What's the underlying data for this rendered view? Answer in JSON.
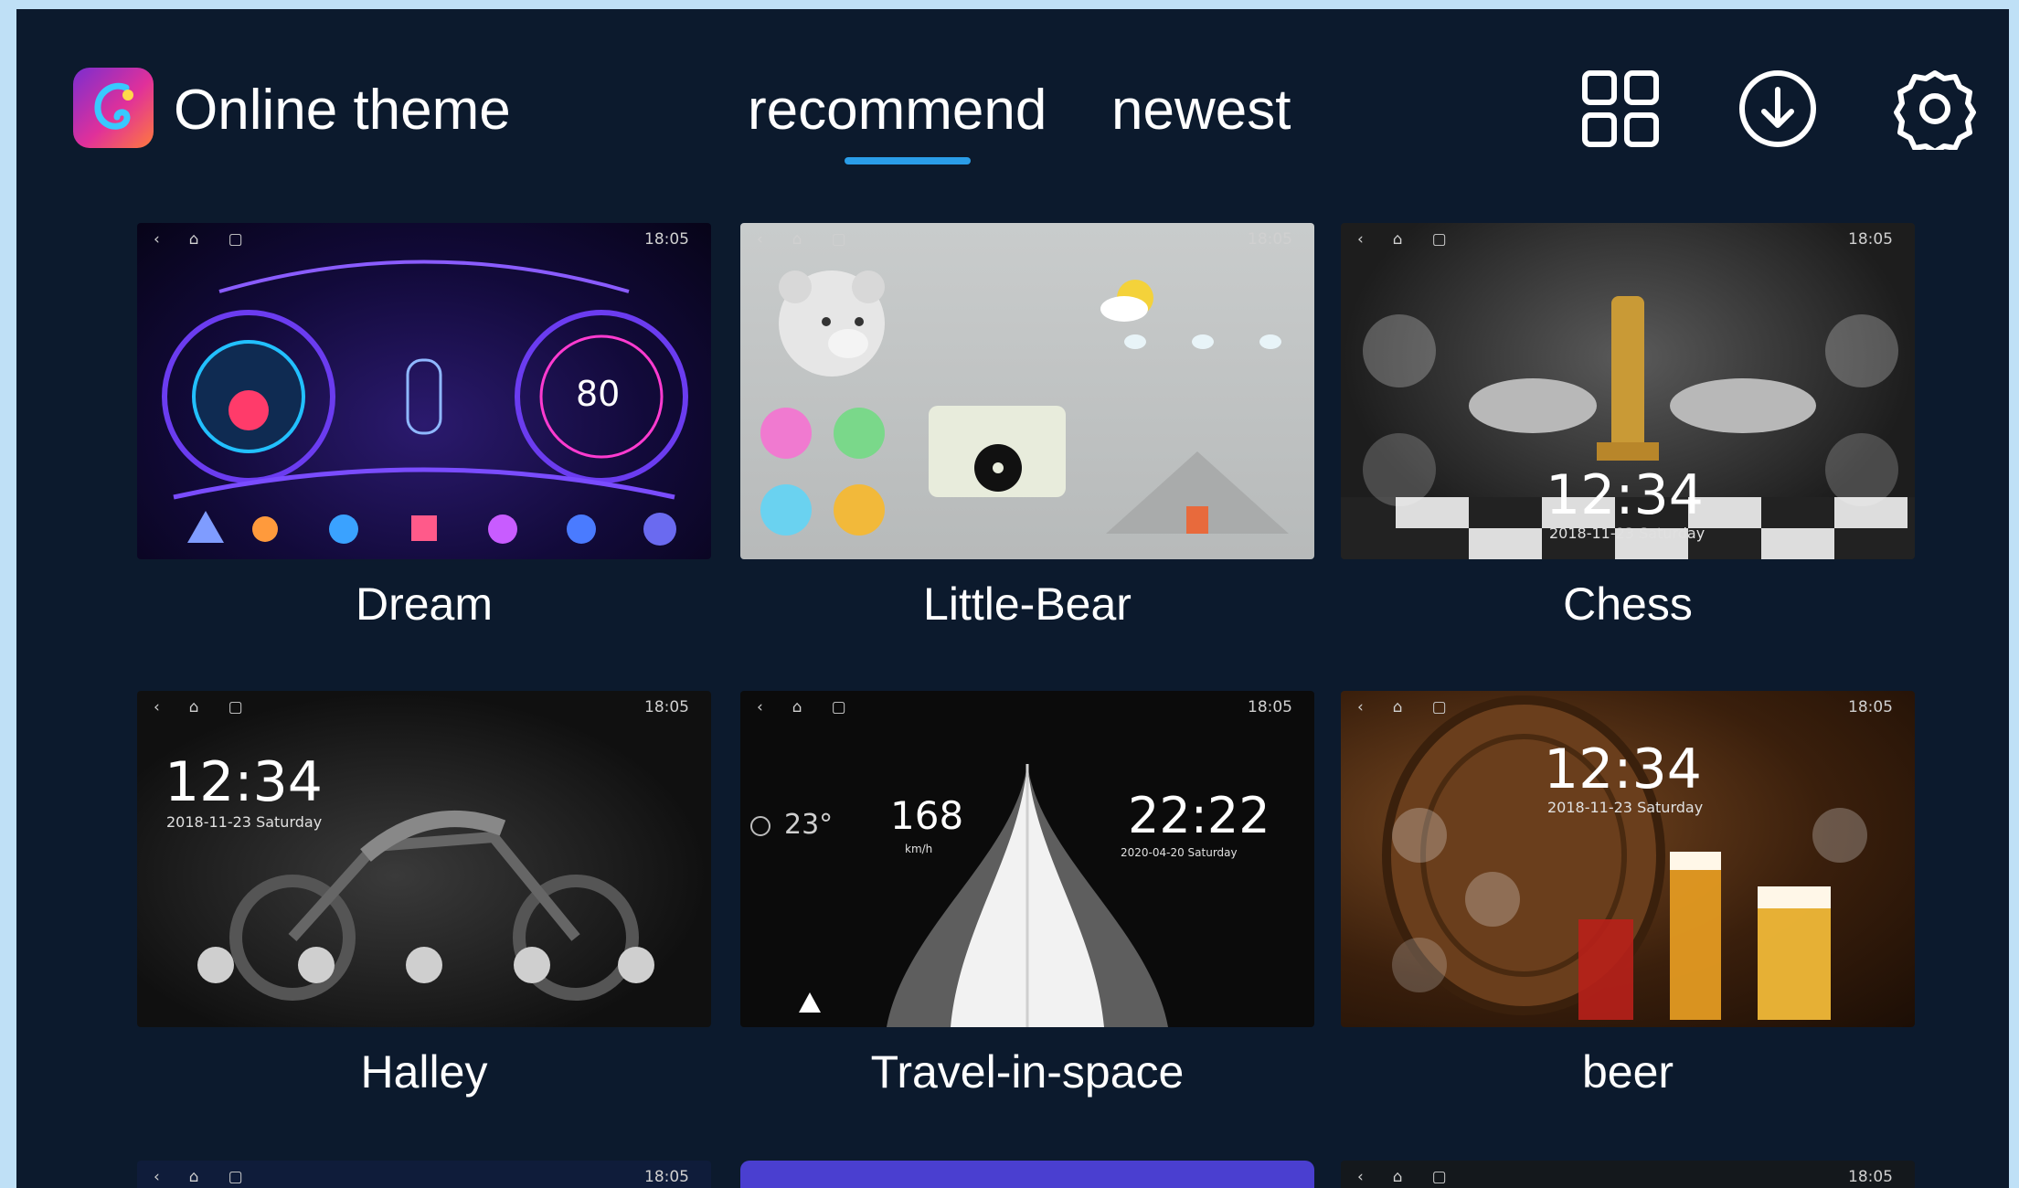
{
  "app": {
    "title": "Online theme",
    "accent_color": "#2a9de8",
    "background_color": "#0c1a2d"
  },
  "tabs": [
    {
      "label": "recommend",
      "active": true
    },
    {
      "label": "newest",
      "active": false
    }
  ],
  "header_actions": [
    {
      "icon": "grid-icon"
    },
    {
      "icon": "download-icon"
    },
    {
      "icon": "settings-icon"
    }
  ],
  "themes": [
    {
      "name": "Dream",
      "time": "18:05",
      "speed": "80"
    },
    {
      "name": "Little-Bear",
      "time": "18:05"
    },
    {
      "name": "Chess",
      "time": "18:05",
      "clock": "12:34",
      "date": "2018-11-23  Saturday"
    },
    {
      "name": "Halley",
      "time": "18:05",
      "clock": "12:34",
      "date": "2018-11-23  Saturday"
    },
    {
      "name": "Travel-in-space",
      "time": "18:05",
      "temp": "23°",
      "speed": "168",
      "speed_unit": "km/h",
      "clock": "22:22",
      "date": "2020-04-20   Saturday"
    },
    {
      "name": "beer",
      "time": "18:05",
      "clock": "12:34",
      "date": "2018-11-23  Saturday"
    }
  ],
  "partial_row": [
    {
      "time": "18:05"
    },
    {},
    {
      "time": "18:05"
    }
  ]
}
